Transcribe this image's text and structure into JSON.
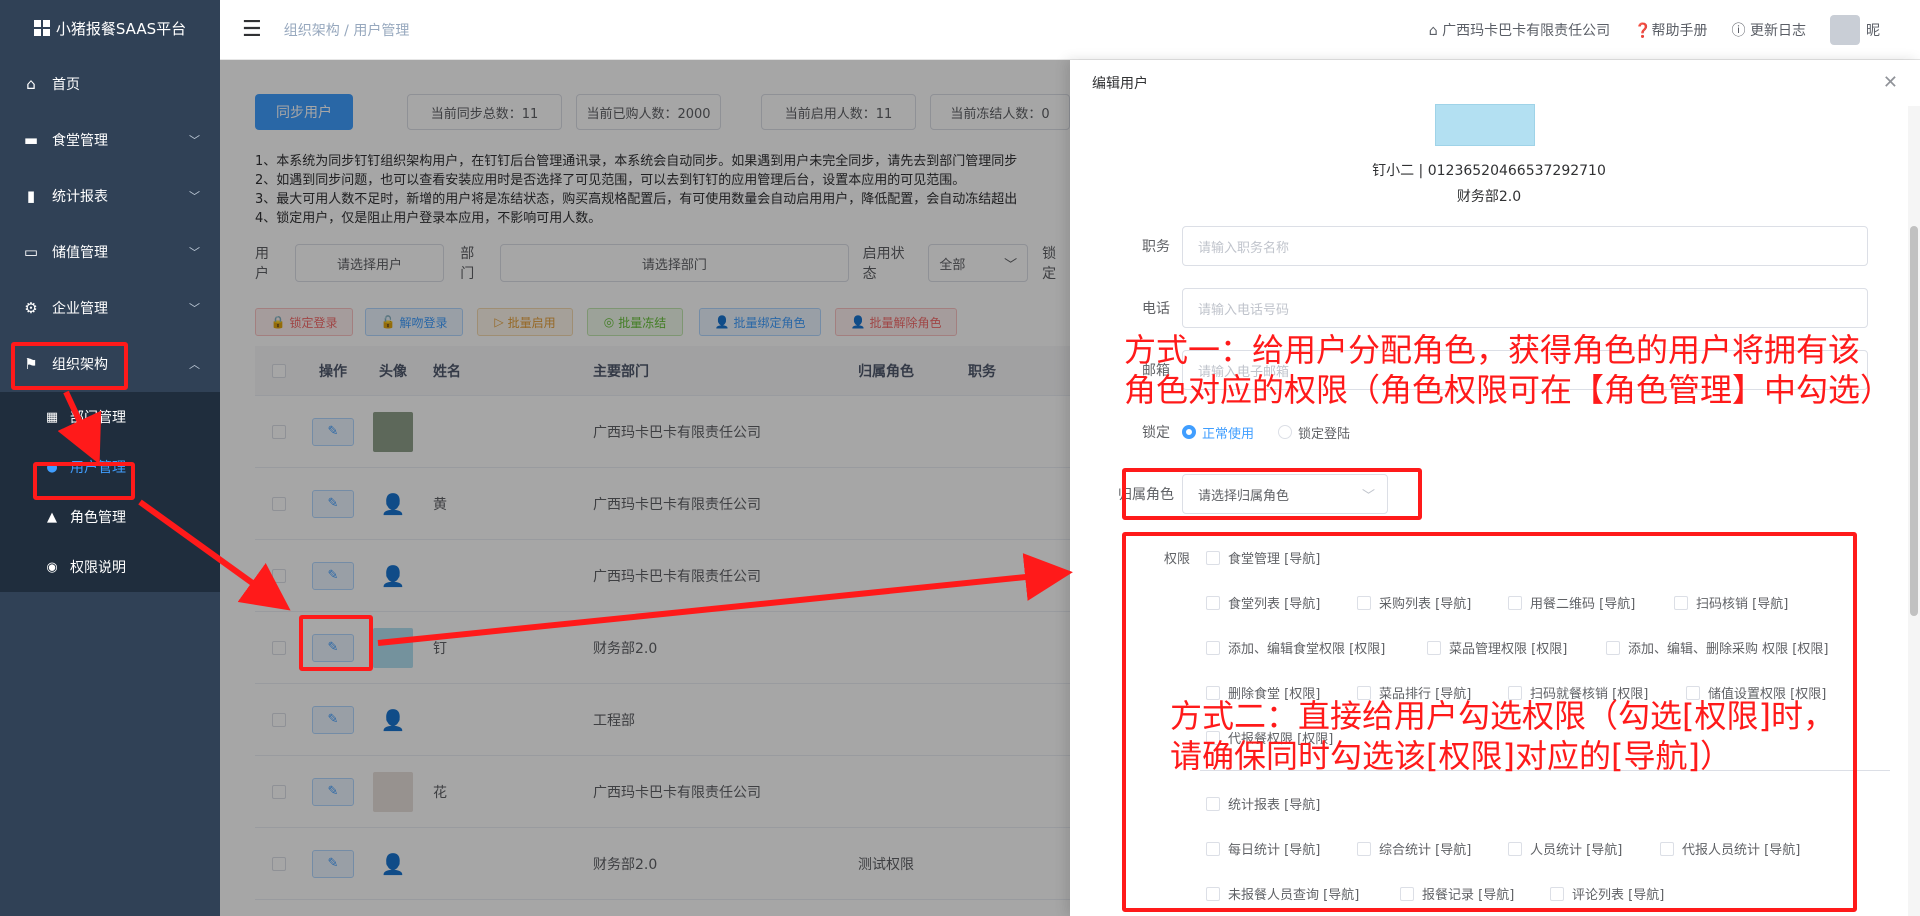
{
  "app": {
    "title": "小猪报餐SAAS平台"
  },
  "sidebar": {
    "items": [
      {
        "label": "首页",
        "icon": "home-icon"
      },
      {
        "label": "食堂管理",
        "icon": "canteen-icon"
      },
      {
        "label": "统计报表",
        "icon": "chart-icon"
      },
      {
        "label": "储值管理",
        "icon": "card-icon"
      },
      {
        "label": "企业管理",
        "icon": "gear-icon"
      },
      {
        "label": "组织架构",
        "icon": "flag-icon"
      }
    ],
    "subitems": [
      {
        "label": "部门管理",
        "icon": "grid-icon"
      },
      {
        "label": "用户管理",
        "icon": "user-icon"
      },
      {
        "label": "角色管理",
        "icon": "person-icon"
      },
      {
        "label": "权限说明",
        "icon": "pin-icon"
      }
    ]
  },
  "topbar": {
    "breadcrumb": "组织架构 / 用户管理",
    "company": "广西玛卡巴卡有限责任公司",
    "help": "帮助手册",
    "changelog": "更新日志",
    "user": "昵"
  },
  "main": {
    "sync_button": "同步用户",
    "stats": [
      "当前同步总数：11",
      "当前已购人数：2000",
      "当前启用人数：11",
      "当前冻结人数：0"
    ],
    "notes": [
      "1、本系统为同步钉钉组织架构用户，在钉钉后台管理通讯录，本系统会自动同步。如果遇到用户未完全同步，请先去到部门管理同步",
      "2、如遇到同步问题，也可以查看安装应用时是否选择了可见范围，可以去到钉钉的应用管理后台，设置本应用的可见范围。",
      "3、最大可用人数不足时，新增的用户将是冻结状态，购买高规格配置后，有可使用数量会自动启用用户，降低配置，会自动冻结超出",
      "4、锁定用户，仅是阻止用户登录本应用，不影响可用人数。"
    ],
    "filters": {
      "user_label": "用户",
      "user_placeholder": "请选择用户",
      "dept_label": "部门",
      "dept_placeholder": "请选择部门",
      "status_label": "启用状态",
      "status_value": "全部",
      "lock_label": "锁定"
    },
    "actions": [
      "锁定登录",
      "解吻登录",
      "批量启用",
      "批量冻结",
      "批量绑定角色",
      "批量解除角色"
    ],
    "table": {
      "columns": [
        "操作",
        "头像",
        "姓名",
        "主要部门",
        "归属角色",
        "职务"
      ],
      "rows": [
        {
          "name": "​",
          "dept": "广西玛卡巴卡有限责任公司",
          "role": ""
        },
        {
          "name": "黄",
          "dept": "广西玛卡巴卡有限责任公司",
          "role": ""
        },
        {
          "name": "​",
          "dept": "广西玛卡巴卡有限责任公司",
          "role": ""
        },
        {
          "name": "钉",
          "dept": "财务部2.0",
          "role": ""
        },
        {
          "name": "​",
          "dept": "工程部",
          "role": ""
        },
        {
          "name": "花",
          "dept": "广西玛卡巴卡有限责任公司",
          "role": ""
        },
        {
          "name": "​",
          "dept": "财务部2.0",
          "role": "测试权限"
        }
      ]
    }
  },
  "drawer": {
    "title": "编辑用户",
    "user_line": "钉小二 | 01236520466537292710",
    "dept_line": "财务部2.0",
    "fields": {
      "job_label": "职务",
      "job_placeholder": "请输入职务名称",
      "phone_label": "电话",
      "phone_placeholder": "请输入电话号码",
      "email_label": "邮箱",
      "email_placeholder": "请输入电子邮箱",
      "lock_label": "锁定",
      "lock_normal": "正常使用",
      "lock_locked": "锁定登陆",
      "role_label": "归属角色",
      "role_placeholder": "请选择归属角色",
      "perm_label": "权限"
    },
    "perms_group1": [
      "食堂管理 [导航]",
      "食堂列表 [导航]",
      "采购列表 [导航]",
      "用餐二维码 [导航]",
      "扫码核销 [导航]",
      "添加、编辑食堂权限 [权限]",
      "菜品管理权限 [权限]",
      "添加、编辑、删除采购 权限 [权限]",
      "删除食堂 [权限]",
      "菜品排行 [导航]",
      "扫码就餐核销 [权限]",
      "储值设置权限 [权限]",
      "代报餐权限 [权限]"
    ],
    "perms_group2": [
      "统计报表 [导航]",
      "每日统计 [导航]",
      "综合统计 [导航]",
      "人员统计 [导航]",
      "代报人员统计 [导航]",
      "未报餐人员查询 [导航]",
      "报餐记录 [导航]",
      "评论列表 [导航]"
    ]
  },
  "annotations": {
    "method1_line1": "方式一：给用户分配角色，获得角色的用户将拥有该",
    "method1_line2": "角色对应的权限（角色权限可在【角色管理】中勾选）",
    "method2_line1": "方式二：直接给用户勾选权限（勾选[权限]时，",
    "method2_line2": "请确保同时勾选该[权限]对应的[导航]）"
  },
  "colors": {
    "sidebar_bg": "#304156",
    "primary": "#409eff",
    "annotation_red": "#ff1a1a"
  }
}
